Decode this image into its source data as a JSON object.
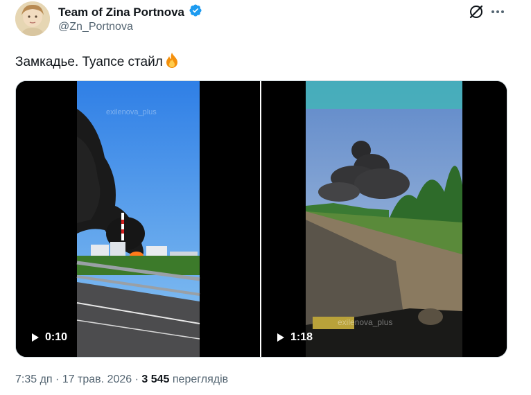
{
  "author": {
    "name": "Team of Zina Portnova",
    "handle": "@Zn_Portnova"
  },
  "tweet": {
    "text": "Замкадье. Туапсе стайл"
  },
  "media": {
    "video1": {
      "duration": "0:10",
      "watermark": "exilenova_plus"
    },
    "video2": {
      "duration": "1:18",
      "watermark": "exilenova_plus"
    }
  },
  "meta": {
    "time": "7:35 дп",
    "separator": " · ",
    "date": "17 трав. 2026",
    "views_count": "3 545",
    "views_label": "переглядів"
  },
  "colors": {
    "verified": "#1d9bf0",
    "secondary_text": "#536471",
    "primary_text": "#0f1419"
  },
  "icons": [
    "verified-badge-icon",
    "grok-icon",
    "more-icon",
    "fire-emoji",
    "play-icon"
  ]
}
